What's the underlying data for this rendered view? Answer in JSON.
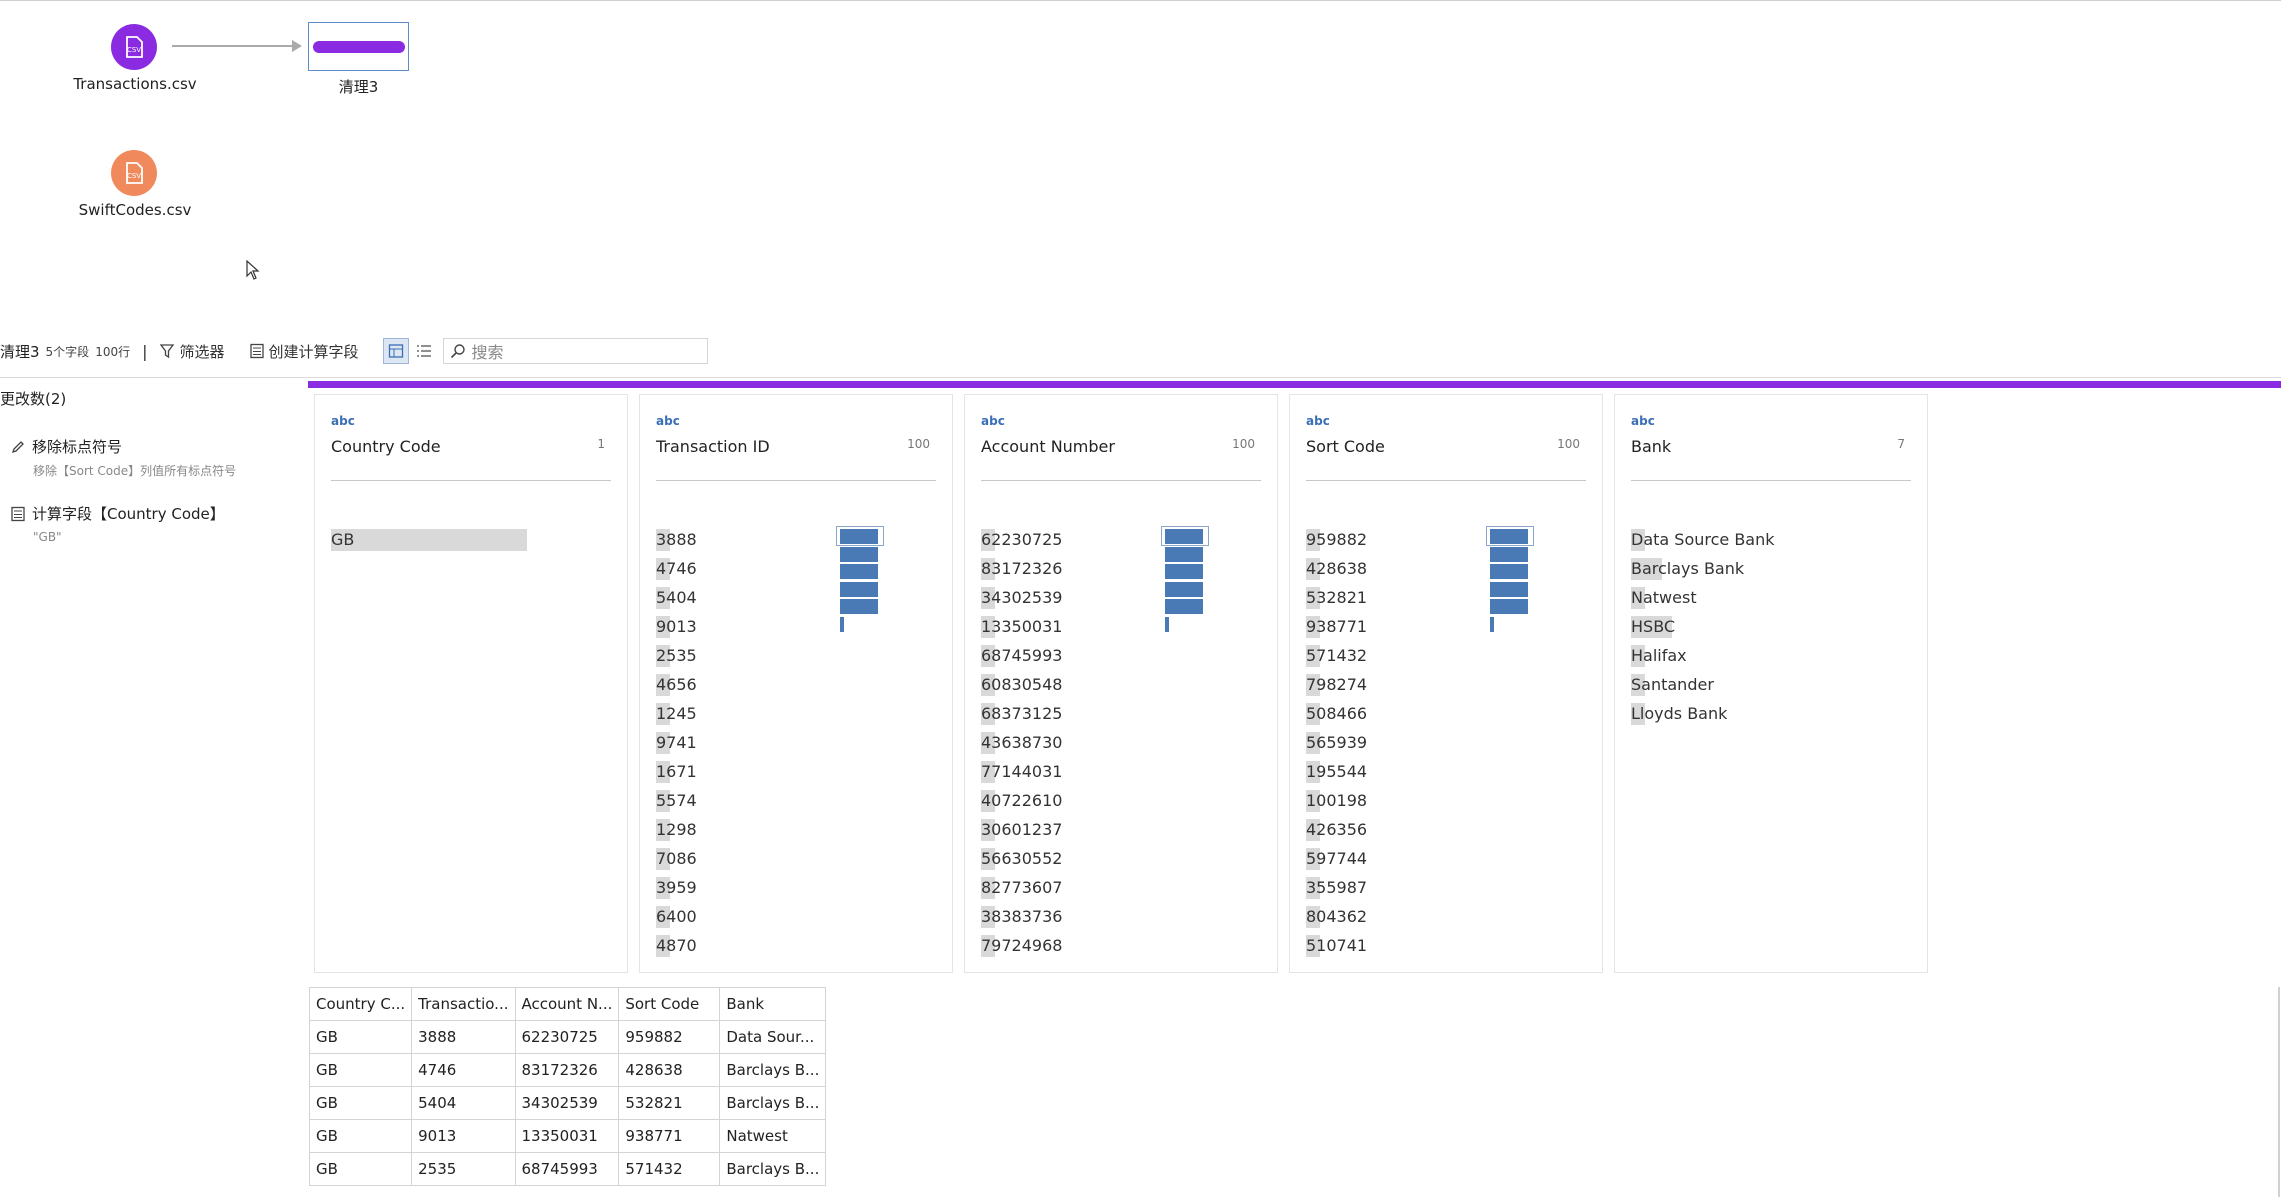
{
  "flow": {
    "nodes": [
      {
        "label": "Transactions.csv",
        "color": "#8a2be2"
      },
      {
        "label": "SwiftCodes.csv",
        "color": "#f08a5d"
      }
    ],
    "clean_step": {
      "label": "清理3",
      "color": "#8a2be2"
    },
    "icon_text": "CSV"
  },
  "toolbar": {
    "title": "清理3",
    "fields": "5个字段",
    "rows": "100行",
    "separator": "|",
    "filter_label": "筛选器",
    "calc_label": "创建计算字段",
    "search_placeholder": "搜索"
  },
  "changes": {
    "title": "更改数(2)",
    "items": [
      {
        "label": "移除标点符号",
        "sub": "移除【Sort Code】列值所有标点符号",
        "icon": "pencil-icon"
      },
      {
        "label": "计算字段【Country Code】",
        "sub": "\"GB\"",
        "icon": "calculator-icon"
      }
    ]
  },
  "cards": [
    {
      "type": "abc",
      "name": "Country Code",
      "count": "1",
      "values": [
        "GB"
      ],
      "value_fill": [
        1.0
      ],
      "histogram": []
    },
    {
      "type": "abc",
      "name": "Transaction ID",
      "count": "100",
      "values": [
        "3888",
        "4746",
        "5404",
        "9013",
        "2535",
        "4656",
        "1245",
        "9741",
        "1671",
        "5574",
        "1298",
        "7086",
        "3959",
        "6400",
        "4870"
      ],
      "value_fill": [
        0.07,
        0.07,
        0.07,
        0.07,
        0.07,
        0.07,
        0.07,
        0.07,
        0.07,
        0.07,
        0.07,
        0.07,
        0.07,
        0.07,
        0.07
      ],
      "histogram": [
        1,
        1,
        1,
        1,
        1,
        0.1
      ]
    },
    {
      "type": "abc",
      "name": "Account Number",
      "count": "100",
      "values": [
        "62230725",
        "83172326",
        "34302539",
        "13350031",
        "68745993",
        "60830548",
        "68373125",
        "43638730",
        "77144031",
        "40722610",
        "30601237",
        "56630552",
        "82773607",
        "38383736",
        "79724968"
      ],
      "value_fill": [
        0.07,
        0.07,
        0.07,
        0.07,
        0.07,
        0.07,
        0.07,
        0.07,
        0.07,
        0.07,
        0.07,
        0.07,
        0.07,
        0.07,
        0.07
      ],
      "histogram": [
        1,
        1,
        1,
        1,
        1,
        0.1
      ]
    },
    {
      "type": "abc",
      "name": "Sort Code",
      "count": "100",
      "values": [
        "959882",
        "428638",
        "532821",
        "938771",
        "571432",
        "798274",
        "508466",
        "565939",
        "195544",
        "100198",
        "426356",
        "597744",
        "355987",
        "804362",
        "510741"
      ],
      "value_fill": [
        0.07,
        0.07,
        0.07,
        0.07,
        0.07,
        0.07,
        0.07,
        0.07,
        0.07,
        0.07,
        0.07,
        0.07,
        0.07,
        0.07,
        0.07
      ],
      "histogram": [
        1,
        1,
        1,
        1,
        1,
        0.1
      ]
    },
    {
      "type": "abc",
      "name": "Bank",
      "count": "7",
      "values": [
        "Data Source Bank",
        "Barclays Bank",
        "Natwest",
        "HSBC",
        "Halifax",
        "Santander",
        "Lloyds Bank"
      ],
      "value_fill": [
        0.07,
        0.16,
        0.07,
        0.21,
        0.07,
        0.07,
        0.07
      ],
      "histogram": []
    }
  ],
  "grid": {
    "headers": [
      "Country C...",
      "Transactio...",
      "Account N...",
      "Sort Code",
      "Bank"
    ],
    "rows": [
      [
        "GB",
        "3888",
        "62230725",
        "959882",
        "Data Sour..."
      ],
      [
        "GB",
        "4746",
        "83172326",
        "428638",
        "Barclays B..."
      ],
      [
        "GB",
        "5404",
        "34302539",
        "532821",
        "Barclays B..."
      ],
      [
        "GB",
        "9013",
        "13350031",
        "938771",
        "Natwest"
      ],
      [
        "GB",
        "2535",
        "68745993",
        "571432",
        "Barclays B..."
      ]
    ]
  },
  "colors": {
    "accent": "#8a2be2",
    "bar": "#4a7ab5",
    "value_bg": "#d9d9d9"
  }
}
